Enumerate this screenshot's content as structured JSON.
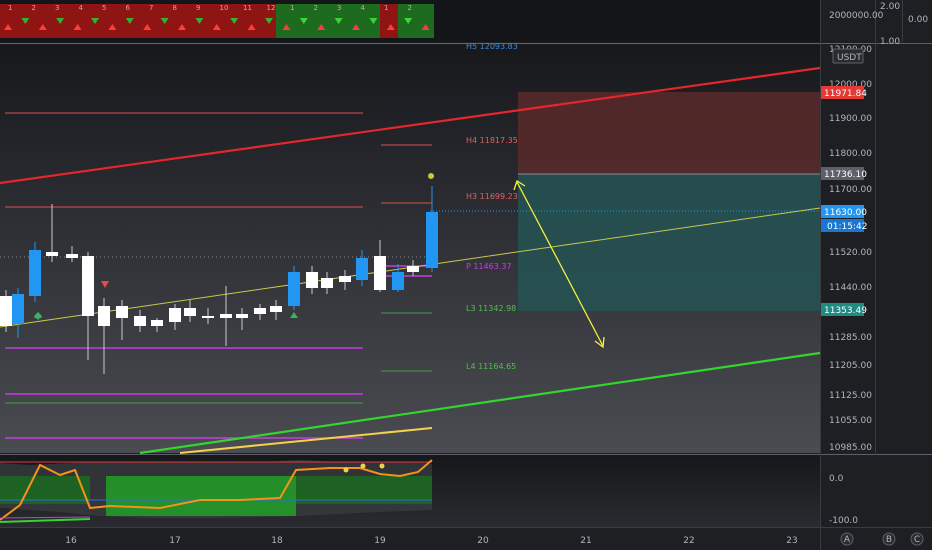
{
  "top_panel": {
    "y_ticks": [
      "2000000.00"
    ],
    "right_ticks": [
      "2.00",
      "1.00"
    ],
    "far_right_tick": "0.00",
    "marker_numbers": [
      "1",
      "2",
      "3",
      "4",
      "5",
      "6",
      "7",
      "8",
      "9",
      "10",
      "11",
      "12",
      "1",
      "2",
      "3",
      "4",
      "1",
      "2"
    ]
  },
  "main_panel": {
    "currency_label": "USDT",
    "y_ticks": [
      "12100.00",
      "12000.00",
      "11900.00",
      "11800.00",
      "11700.00",
      "11520.00",
      "11440.00",
      "11285.00",
      "11205.00",
      "11125.00",
      "11055.00",
      "10985.00"
    ],
    "price_tags": {
      "red": "11971.84",
      "gray": "11736.10",
      "current": "11630.00",
      "countdown": "01:15:42",
      "green": "11353.49"
    },
    "pivot_labels": {
      "h5": "H5 12093.83",
      "h4": "H4 11817.35",
      "h3": "H3 11699.23",
      "p": "P 11463.37",
      "l3": "L3 11342.98",
      "l4": "L4 11164.65"
    }
  },
  "oscillator_panel": {
    "y_ticks": [
      "0.0",
      "-100.0"
    ]
  },
  "time_axis": {
    "labels": [
      "16",
      "17",
      "18",
      "19",
      "20",
      "21",
      "22",
      "23"
    ]
  },
  "axis_buttons": [
    "A",
    "B",
    "C"
  ],
  "colors": {
    "background": "#1e1f23",
    "up_candle": "#2196f3",
    "down_candle": "#ffffff",
    "resistance": "#e53935",
    "support": "#35d42f",
    "arrow": "#f2f23c",
    "oscillator_line": "#f5921b"
  }
}
